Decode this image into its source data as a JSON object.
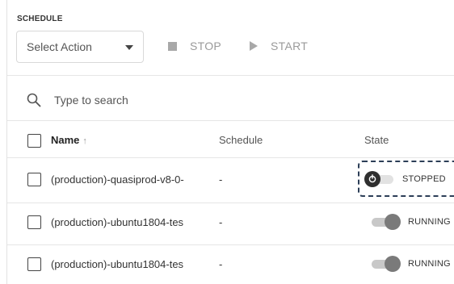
{
  "panel": {
    "section_title": "SCHEDULE",
    "select": {
      "placeholder": "Select Action"
    },
    "actions": {
      "stop_label": "STOP",
      "start_label": "START"
    },
    "search": {
      "placeholder": "Type to search"
    }
  },
  "table": {
    "columns": {
      "name": "Name",
      "sort_indicator": "↑",
      "schedule": "Schedule",
      "state": "State"
    },
    "rows": [
      {
        "name": "(production)-quasiprod-v8-0-",
        "schedule": "-",
        "state": "STOPPED",
        "running": false
      },
      {
        "name": "(production)-ubuntu1804-tes",
        "schedule": "-",
        "state": "RUNNING",
        "running": true
      },
      {
        "name": "(production)-ubuntu1804-tes",
        "schedule": "-",
        "state": "RUNNING",
        "running": true
      }
    ]
  },
  "colors": {
    "toggle_off_knob": "#2f2f2f",
    "toggle_on_knob": "#7a7a7a",
    "focus_ring": "#2c3e57",
    "action_disabled": "#9a9a9a"
  },
  "icons": {
    "search": "search-icon",
    "stop": "stop-icon",
    "start": "play-icon",
    "caret": "chevron-down-icon",
    "power": "power-icon"
  }
}
